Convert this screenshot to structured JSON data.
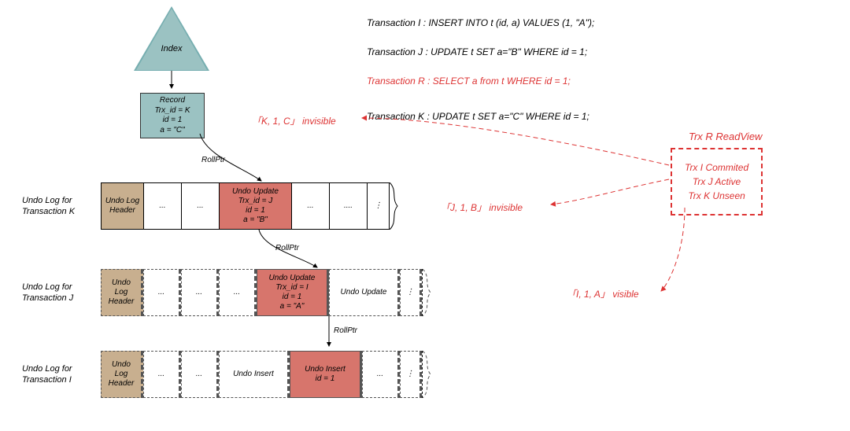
{
  "index": {
    "label": "Index"
  },
  "record": {
    "title": "Record",
    "line1": "Trx_id = K",
    "line2": "id = 1",
    "line3": "a = \"C\""
  },
  "sql": {
    "i": "Transaction I  :  INSERT  INTO  t  (id, a)  VALUES  (1, \"A\");",
    "j": "Transaction J  :  UPDATE  t  SET  a=\"B\"  WHERE  id = 1;",
    "r": "Transaction R :   SELECT a from t WHERE id = 1;",
    "k": "Transaction K  :  UPDATE  t  SET  a=\"C\"  WHERE  id = 1;"
  },
  "rows": {
    "k": {
      "label": "Undo Log for\nTransaction K",
      "header": "Undo Log\nHeader",
      "cells": [
        "...",
        "...",
        "",
        "...",
        "....",
        "⋮"
      ],
      "main": {
        "t": "Undo Update",
        "l1": "Trx_id = J",
        "l2": "id = 1",
        "l3": "a = \"B\""
      }
    },
    "j": {
      "label": "Undo Log for\nTransaction J",
      "header": "Undo Log\nHeader",
      "cells": [
        "...",
        "...",
        "...",
        "",
        "Undo Update",
        "⋮"
      ],
      "main": {
        "t": "Undo Update",
        "l1": "Trx_id = I",
        "l2": "id = 1",
        "l3": "a = \"A\""
      }
    },
    "i": {
      "label": "Undo Log for\nTransaction I",
      "header": "Undo Log\nHeader",
      "cells": [
        "...",
        "...",
        "Undo Insert",
        "",
        "...",
        "⋮"
      ],
      "main": {
        "t": "Undo Insert",
        "l1": "id = 1"
      }
    }
  },
  "rollptr": "RollPtr",
  "visibility": {
    "k": "「K, 1, C」 invisible",
    "j": "「J, 1, B」 invisible",
    "i": "「I, 1, A」 visible"
  },
  "readview": {
    "title": "Trx R ReadView",
    "l1": "Trx I Commited",
    "l2": "Trx J Active",
    "l3": "Trx K Unseen"
  }
}
